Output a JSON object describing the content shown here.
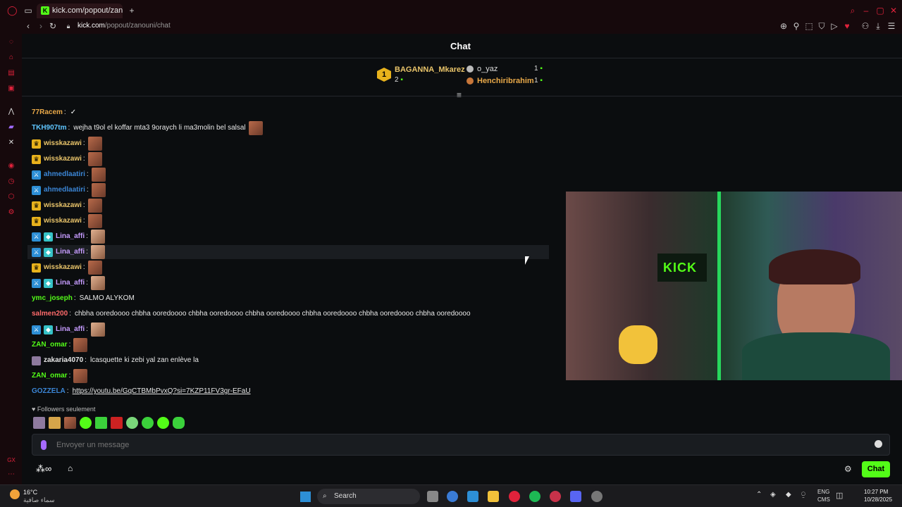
{
  "browser": {
    "tab_title": "kick.com/popout/zanouni",
    "url_host": "kick.com",
    "url_path": "/popout/zanouni/chat"
  },
  "chat": {
    "title": "Chat",
    "leaderboard": {
      "first": {
        "rank": "1",
        "name": "BAGANNA_Mkarez",
        "count": "2"
      },
      "second": {
        "name": "o_yaz",
        "count": "1"
      },
      "third": {
        "name": "Henchiribrahim",
        "count": "1"
      }
    },
    "messages": [
      {
        "user": "77Racem",
        "text": "",
        "color": "#e9a949",
        "badges": [],
        "emotes": 0,
        "swoosh": true
      },
      {
        "user": "TKH907tm",
        "text": "wejha t9ol el koffar mta3 9oraych li ma3molin bel salsal",
        "color": "#5fc6ff",
        "badges": [],
        "emotes": 1
      },
      {
        "user": "wisskazawi",
        "text": "",
        "color": "#e9c46a",
        "badges": [
          "crown"
        ],
        "emotes": 1
      },
      {
        "user": "wisskazawi",
        "text": "",
        "color": "#e9c46a",
        "badges": [
          "crown"
        ],
        "emotes": 1
      },
      {
        "user": "ahmedlaatiri",
        "text": "",
        "color": "#3b86d6",
        "badges": [
          "mod"
        ],
        "emotes": 1
      },
      {
        "user": "ahmedlaatiri",
        "text": "",
        "color": "#3b86d6",
        "badges": [
          "mod"
        ],
        "emotes": 1
      },
      {
        "user": "wisskazawi",
        "text": "",
        "color": "#e9c46a",
        "badges": [
          "crown"
        ],
        "emotes": 1
      },
      {
        "user": "wisskazawi",
        "text": "",
        "color": "#e9c46a",
        "badges": [
          "crown"
        ],
        "emotes": 1
      },
      {
        "user": "Lina_affi",
        "text": "",
        "color": "#c69cff",
        "badges": [
          "mod",
          "sub"
        ],
        "emotes": 1,
        "light": true
      },
      {
        "user": "Lina_affi",
        "text": "",
        "color": "#c69cff",
        "badges": [
          "mod",
          "sub"
        ],
        "emotes": 1,
        "light": true,
        "highlight": true
      },
      {
        "user": "wisskazawi",
        "text": "",
        "color": "#e9c46a",
        "badges": [
          "crown"
        ],
        "emotes": 1
      },
      {
        "user": "Lina_affi",
        "text": "",
        "color": "#c69cff",
        "badges": [
          "mod",
          "sub"
        ],
        "emotes": 1,
        "light": true
      },
      {
        "user": "ymc_joseph",
        "text": "SALMO ALYKOM",
        "color": "#53fc18",
        "badges": [],
        "emotes": 0
      },
      {
        "user": "salmen200",
        "text": "chbha ooredoooo chbha ooredoooo chbha ooredoooo chbha ooredoooo chbha ooredoooo chbha ooredoooo chbha ooredoooo",
        "color": "#ff6b6b",
        "badges": [],
        "emotes": 0
      },
      {
        "user": "Lina_affi",
        "text": "",
        "color": "#c69cff",
        "badges": [
          "mod",
          "sub"
        ],
        "emotes": 1,
        "light": true
      },
      {
        "user": "ZAN_omar",
        "text": "",
        "color": "#53fc18",
        "badges": [],
        "emotes": 1
      },
      {
        "user": "zakaria4070",
        "text": "lcasquette ki zebi yal zan enlève la",
        "color": "#e6e6e6",
        "badges": [
          "small"
        ],
        "emotes": 0
      },
      {
        "user": "ZAN_omar",
        "text": "",
        "color": "#53fc18",
        "badges": [],
        "emotes": 1
      },
      {
        "user": "GOZZELA",
        "text": "https://youtu.be/GqCTBMbPvxQ?si=7KZP11FV3gr-EFaU",
        "color": "#3b86d6",
        "badges": [],
        "emotes": 0,
        "link": true
      }
    ],
    "followers_only": "Followers seulement",
    "input_placeholder": "Envoyer un message",
    "send_label": "Chat"
  },
  "webcam_overlay": {
    "sign_text": "KICK"
  },
  "taskbar": {
    "weather_temp": "16°C",
    "weather_desc": "سماء صافية",
    "search_label": "Search",
    "lang": "ENG",
    "lang_sub": "CMS",
    "time": "10:27 PM",
    "date": "10/28/2025"
  },
  "colors": {
    "accent": "#53fc18",
    "browser_red": "#e0223b"
  }
}
